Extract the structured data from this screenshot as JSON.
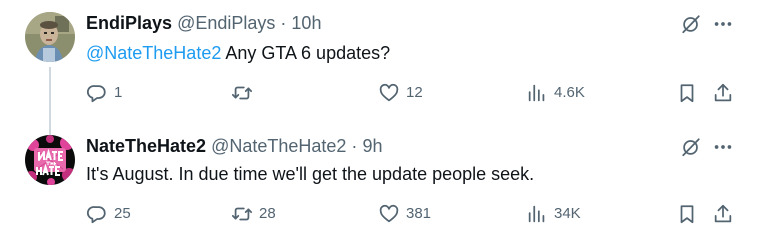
{
  "tweets": [
    {
      "author_name": "EndiPlays",
      "author_handle": "@EndiPlays",
      "separator": "·",
      "time": "10h",
      "mention": "@NateTheHate2",
      "text": " Any GTA 6 updates?",
      "replies": "1",
      "retweets": "",
      "likes": "12",
      "views": "4.6K"
    },
    {
      "author_name": "NateTheHate2",
      "author_handle": "@NateTheHate2",
      "separator": "·",
      "time": "9h",
      "mention": "",
      "text": "It's August. In due time we'll get the update people seek.",
      "replies": "25",
      "retweets": "28",
      "likes": "381",
      "views": "34K"
    }
  ],
  "icons": {
    "reply": "reply-icon",
    "retweet": "retweet-icon",
    "like": "heart-icon",
    "views": "views-icon",
    "bookmark": "bookmark-icon",
    "share": "share-icon",
    "grok": "grok-icon",
    "more": "more-icon"
  },
  "avatar_logo_text": "NATE THE HATE",
  "colors": {
    "text": "#0f1419",
    "secondary": "#536471",
    "mention": "#1d9bf0",
    "thread_line": "#cfd9de",
    "avatar2_accent": "#e0449a"
  }
}
